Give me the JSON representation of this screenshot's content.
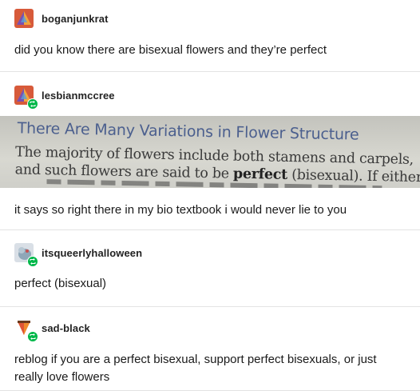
{
  "posts": [
    {
      "username": "boganjunkrat",
      "avatar_icon": "avatar-boganjunkrat-icon",
      "reblog": false,
      "text": "did you know there are bisexual flowers and they’re perfect"
    },
    {
      "username": "lesbianmccree",
      "avatar_icon": "avatar-lesbianmccree-icon",
      "reblog": true,
      "photo": {
        "heading": "There Are Many Variations in Flower Structure",
        "line1": "The majority of flowers include both stamens and carpels,",
        "line2_pre": "and such flowers are said to be ",
        "line2_bold": "perfect",
        "line2_post": " (bisexual). If either"
      },
      "text": "it says so right there in my bio textbook i would never lie to you"
    },
    {
      "username": "itsqueerlyhalloween",
      "avatar_icon": "avatar-itsqueerlyhalloween-icon",
      "reblog": true,
      "text": "perfect (bisexual)"
    },
    {
      "username": "sad-black",
      "avatar_icon": "avatar-sad-black-icon",
      "reblog": true,
      "text": "reblog if you are a perfect bisexual, support perfect bisexuals, or just really love flowers"
    }
  ],
  "colors": {
    "reblog_badge": "#00b84a",
    "divider": "#e3e3e3",
    "textbook_heading": "#4b5f8e"
  }
}
